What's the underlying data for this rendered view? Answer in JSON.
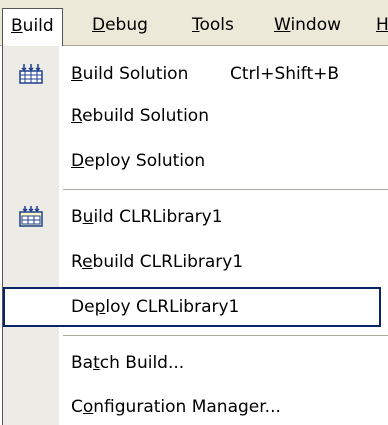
{
  "menubar": {
    "items": [
      {
        "prefix": "",
        "mnemonic": "B",
        "rest": "uild"
      },
      {
        "prefix": "",
        "mnemonic": "D",
        "rest": "ebug"
      },
      {
        "prefix": "",
        "mnemonic": "T",
        "rest": "ools"
      },
      {
        "prefix": "",
        "mnemonic": "W",
        "rest": "indow"
      },
      {
        "prefix": "",
        "mnemonic": "H",
        "rest": ""
      }
    ]
  },
  "menu": {
    "items": [
      {
        "prefix": "",
        "mnemonic": "B",
        "rest": "uild Solution",
        "shortcut": "Ctrl+Shift+B",
        "icon": "build-solution-icon"
      },
      {
        "prefix": "",
        "mnemonic": "R",
        "rest": "ebuild Solution"
      },
      {
        "prefix": "",
        "mnemonic": "D",
        "rest": "eploy Solution"
      },
      {
        "prefix": "B",
        "mnemonic": "u",
        "rest": "ild CLRLibrary1",
        "icon": "build-project-icon"
      },
      {
        "prefix": "R",
        "mnemonic": "e",
        "rest": "build CLRLibrary1"
      },
      {
        "prefix": "De",
        "mnemonic": "p",
        "rest": "loy CLRLibrary1",
        "highlighted": true
      },
      {
        "prefix": "Ba",
        "mnemonic": "t",
        "rest": "ch Build..."
      },
      {
        "prefix": "C",
        "mnemonic": "o",
        "rest": "nfiguration Manager..."
      }
    ]
  },
  "colors": {
    "menubar_bg": "#ece9d8",
    "gutter_bg": "#ecebe5",
    "highlight_border": "#0a246a",
    "separator": "#aca899"
  }
}
